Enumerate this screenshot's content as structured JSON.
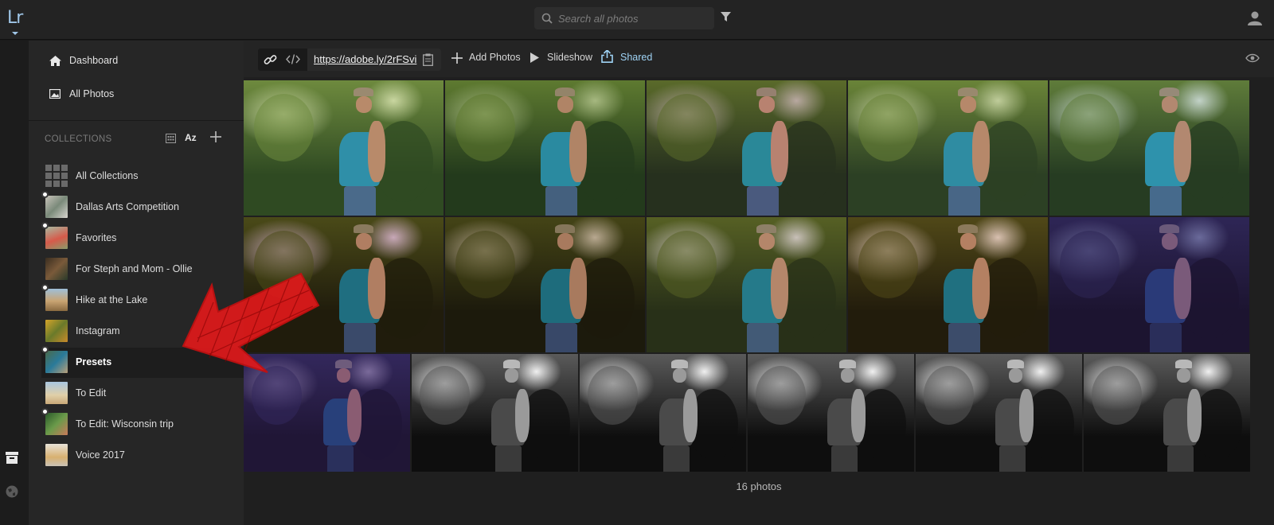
{
  "app": {
    "logo": "Lr"
  },
  "search": {
    "placeholder": "Search all photos"
  },
  "sidebar": {
    "nav": [
      {
        "label": "Dashboard",
        "icon": "home-icon"
      },
      {
        "label": "All Photos",
        "icon": "image-icon"
      }
    ],
    "collections_header": "COLLECTIONS",
    "sort_label": "Az",
    "collections": [
      {
        "label": "All Collections",
        "shared": false,
        "selected": false
      },
      {
        "label": "Dallas Arts Competition",
        "shared": true,
        "selected": false
      },
      {
        "label": "Favorites",
        "shared": true,
        "selected": false
      },
      {
        "label": "For Steph and Mom - Ollie",
        "shared": false,
        "selected": false
      },
      {
        "label": "Hike at the Lake",
        "shared": true,
        "selected": false
      },
      {
        "label": "Instagram",
        "shared": false,
        "selected": false
      },
      {
        "label": "Presets",
        "shared": true,
        "selected": true
      },
      {
        "label": "To Edit",
        "shared": false,
        "selected": false
      },
      {
        "label": "To Edit: Wisconsin trip",
        "shared": true,
        "selected": false
      },
      {
        "label": "Voice 2017",
        "shared": false,
        "selected": false
      }
    ]
  },
  "toolbar": {
    "share_url": "https://adobe.ly/2rFSvi",
    "add_photos": "Add Photos",
    "slideshow": "Slideshow",
    "shared": "Shared"
  },
  "photos": {
    "count_label": "16 photos",
    "items": [
      {
        "tone": "warm-green"
      },
      {
        "tone": "green"
      },
      {
        "tone": "magenta-green"
      },
      {
        "tone": "neutral-green"
      },
      {
        "tone": "cool-green"
      },
      {
        "tone": "olive"
      },
      {
        "tone": "dark-olive"
      },
      {
        "tone": "faded-olive"
      },
      {
        "tone": "orange-olive"
      },
      {
        "tone": "purple"
      },
      {
        "tone": "purple-dark"
      },
      {
        "tone": "bw"
      },
      {
        "tone": "bw"
      },
      {
        "tone": "bw"
      },
      {
        "tone": "bw"
      },
      {
        "tone": "bw"
      }
    ]
  },
  "colors": {
    "accent": "#9fd3f5",
    "logo": "#9fc6e8",
    "annotation": "#e0191b"
  }
}
